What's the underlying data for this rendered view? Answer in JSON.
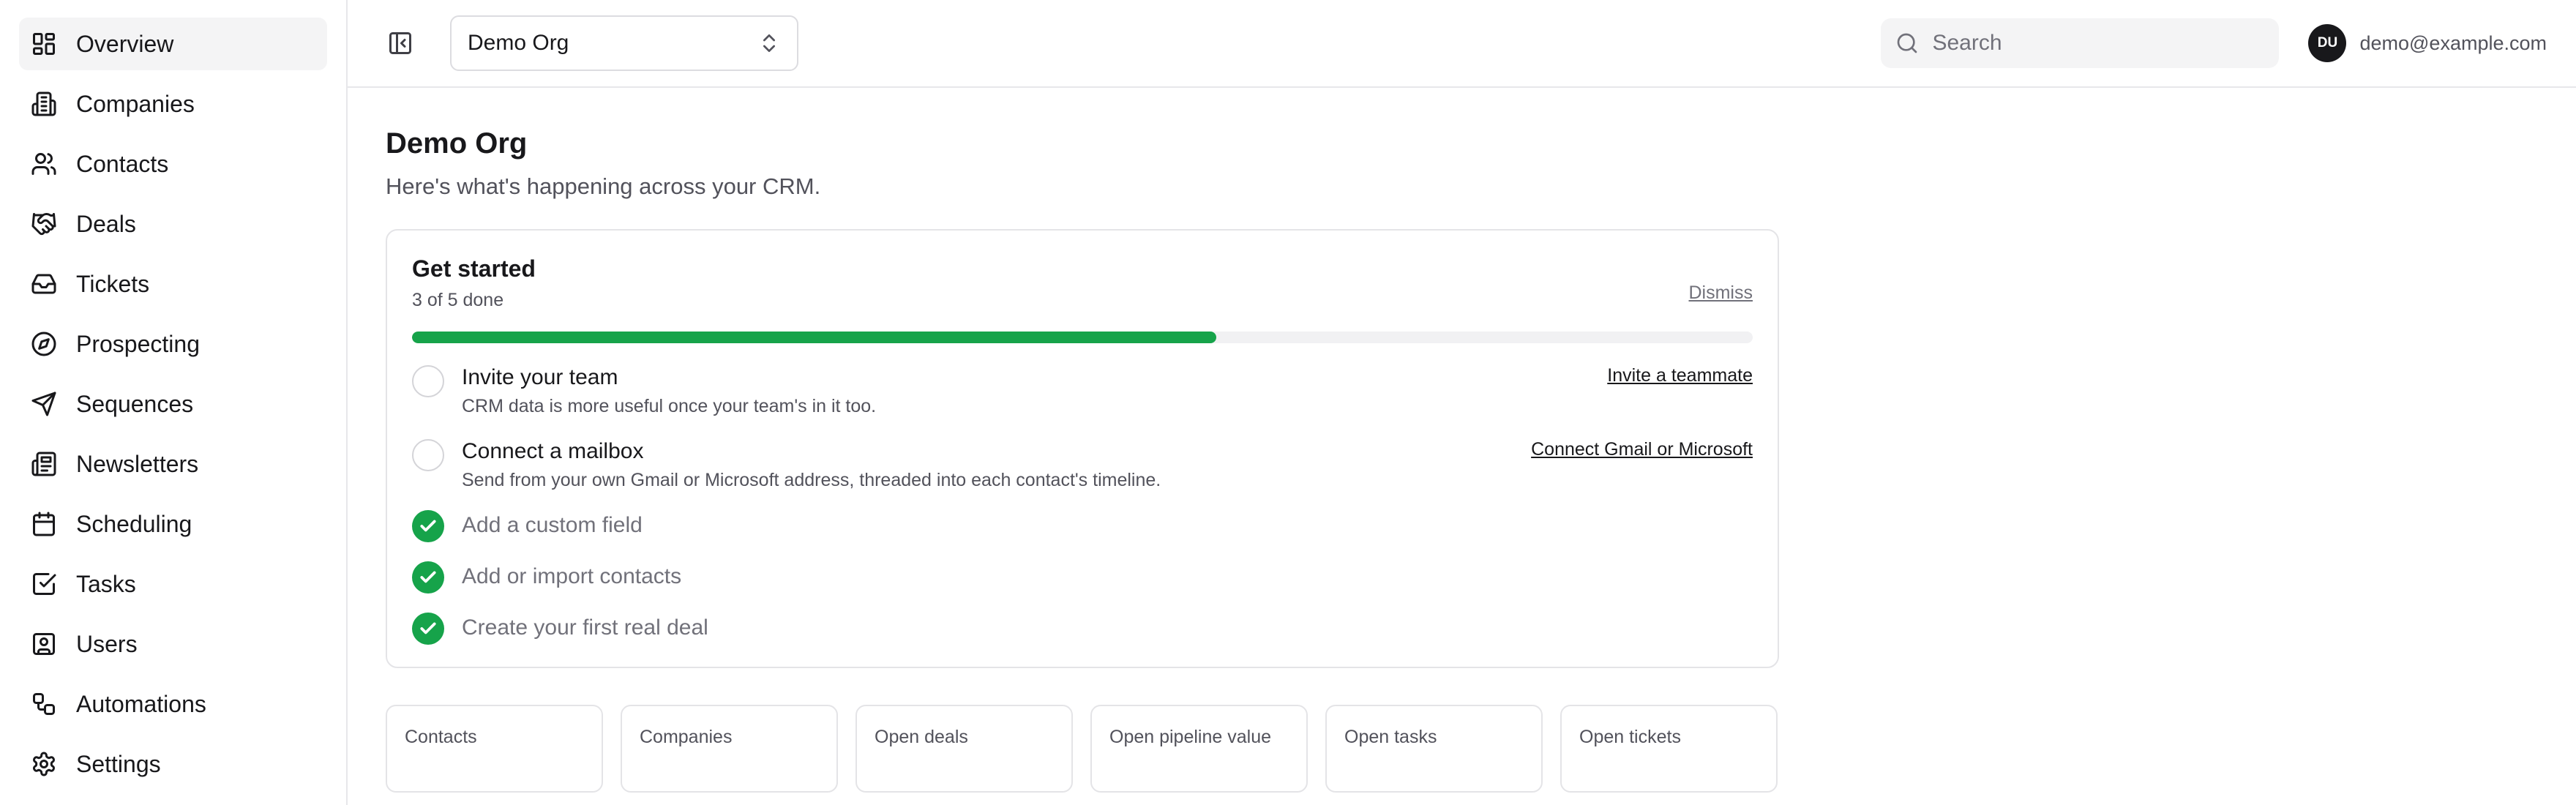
{
  "sidebar": {
    "items": [
      {
        "label": "Overview",
        "icon": "layout-grid-icon",
        "active": true
      },
      {
        "label": "Companies",
        "icon": "building-icon"
      },
      {
        "label": "Contacts",
        "icon": "users-icon"
      },
      {
        "label": "Deals",
        "icon": "handshake-icon"
      },
      {
        "label": "Tickets",
        "icon": "inbox-icon"
      },
      {
        "label": "Prospecting",
        "icon": "compass-icon"
      },
      {
        "label": "Sequences",
        "icon": "send-icon"
      },
      {
        "label": "Newsletters",
        "icon": "newspaper-icon"
      },
      {
        "label": "Scheduling",
        "icon": "calendar-icon"
      },
      {
        "label": "Tasks",
        "icon": "check-square-icon"
      },
      {
        "label": "Users",
        "icon": "user-square-icon"
      },
      {
        "label": "Automations",
        "icon": "workflow-icon"
      },
      {
        "label": "Settings",
        "icon": "gear-icon"
      }
    ]
  },
  "topbar": {
    "org_name": "Demo Org",
    "search_placeholder": "Search",
    "avatar_initials": "DU",
    "user_email": "demo@example.com"
  },
  "page": {
    "title": "Demo Org",
    "subtitle": "Here's what's happening across your CRM."
  },
  "get_started": {
    "title": "Get started",
    "progress_text": "3 of 5 done",
    "progress_fraction": 0.6,
    "dismiss_label": "Dismiss",
    "tasks": [
      {
        "title": "Invite your team",
        "description": "CRM data is more useful once your team's in it too.",
        "link": "Invite a teammate",
        "done": false
      },
      {
        "title": "Connect a mailbox",
        "description": "Send from your own Gmail or Microsoft address, threaded into each contact's timeline.",
        "link": "Connect Gmail or Microsoft",
        "done": false
      },
      {
        "title": "Add a custom field",
        "done": true
      },
      {
        "title": "Add or import contacts",
        "done": true
      },
      {
        "title": "Create your first real deal",
        "done": true
      }
    ]
  },
  "stats": [
    {
      "label": "Contacts"
    },
    {
      "label": "Companies"
    },
    {
      "label": "Open deals"
    },
    {
      "label": "Open pipeline value"
    },
    {
      "label": "Open tasks"
    },
    {
      "label": "Open tickets"
    }
  ],
  "colors": {
    "accent": "#16a34a",
    "text": "#18181b",
    "muted": "#71717a",
    "border": "#e4e4e7"
  }
}
